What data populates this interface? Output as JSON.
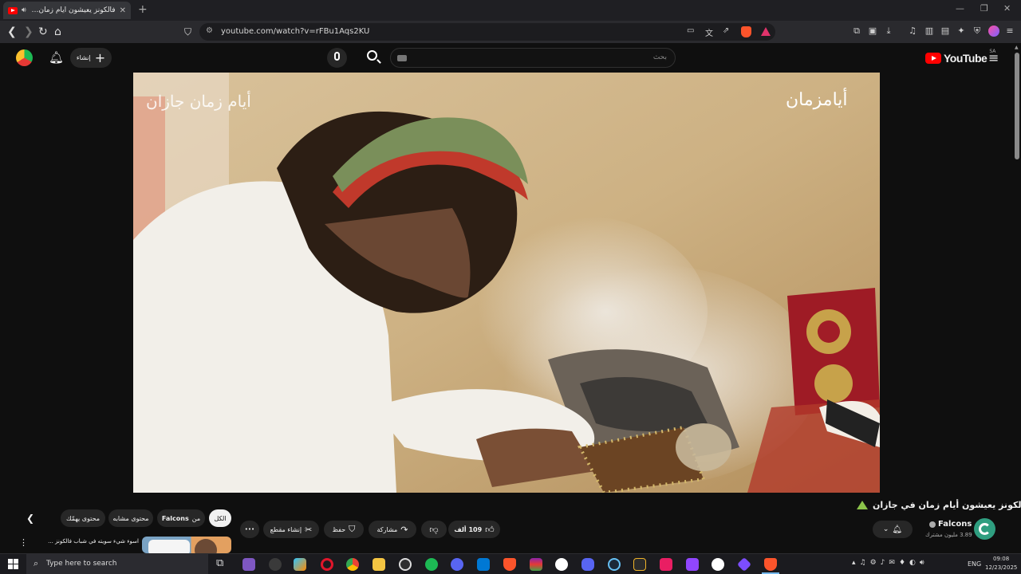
{
  "browser": {
    "tab_title": "فالكونز يعيشون أيام زمان في جازان",
    "tab_new": "+",
    "url": "youtube.com/watch?v=rFBu1Aqs2KU",
    "window_controls": [
      "—",
      "❐",
      "✕"
    ]
  },
  "youtube": {
    "logo_text": "YouTube",
    "region": "SA",
    "search_placeholder": "بحث",
    "create_label": "إنشاء"
  },
  "video": {
    "watermark_left": "أيام زمان جازان",
    "watermark_right": "أيامزمان"
  },
  "details": {
    "title": "فالكونز يعيشون أيام زمان في جازان",
    "channel_name": "Falcons",
    "subscribers": "3.89 مليون مشترك",
    "likes": "109 ألف",
    "share_label": "مشاركة",
    "save_label": "حفظ",
    "clip_label": "إنشاء مقطع",
    "more_label": "•••"
  },
  "chips": {
    "all": "الكل",
    "from_channel_prefix": "من",
    "from_channel_name": "Falcons",
    "related": "محتوى مشابه",
    "for_you": "محتوى يهمّك"
  },
  "recommendation": {
    "title": "اسوء شيء سويته في شباب فالكونز ..."
  },
  "taskbar": {
    "search_placeholder": "Type here to search",
    "lang": "ENG",
    "time": "09:08",
    "date": "12/23/2025"
  },
  "colors": {
    "youtube_red": "#ff0000",
    "background": "#0f0f0f",
    "chip_bg": "#272727",
    "windows_blue": "#0078d4"
  }
}
